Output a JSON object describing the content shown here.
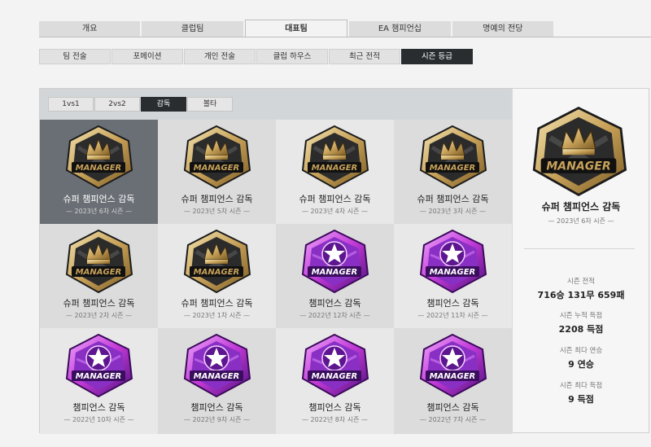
{
  "main_tabs": [
    {
      "label": "개요",
      "active": false
    },
    {
      "label": "클럽팀",
      "active": false
    },
    {
      "label": "대표팀",
      "active": true
    },
    {
      "label": "EA 챔피언십",
      "active": false
    },
    {
      "label": "명예의 전당",
      "active": false
    }
  ],
  "sub_tabs": [
    {
      "label": "팀 전술",
      "active": false
    },
    {
      "label": "포메이션",
      "active": false
    },
    {
      "label": "개인 전술",
      "active": false
    },
    {
      "label": "클럽 하우스",
      "active": false
    },
    {
      "label": "최근 전적",
      "active": false
    },
    {
      "label": "시즌 등급",
      "active": true
    }
  ],
  "mode_tabs": [
    {
      "label": "1vs1",
      "active": false
    },
    {
      "label": "2vs2",
      "active": false
    },
    {
      "label": "감독",
      "active": true
    },
    {
      "label": "볼타",
      "active": false
    }
  ],
  "badge_text": "MANAGER",
  "badges": [
    {
      "name": "슈퍼 챔피언스 감독",
      "season": "— 2023년 6차 시즌 —",
      "tier": "super",
      "selected": true
    },
    {
      "name": "슈퍼 챔피언스 감독",
      "season": "— 2023년 5차 시즌 —",
      "tier": "super",
      "selected": false
    },
    {
      "name": "슈퍼 챔피언스 감독",
      "season": "— 2023년 4차 시즌 —",
      "tier": "super",
      "selected": false
    },
    {
      "name": "슈퍼 챔피언스 감독",
      "season": "— 2023년 3차 시즌 —",
      "tier": "super",
      "selected": false
    },
    {
      "name": "슈퍼 챔피언스 감독",
      "season": "— 2023년 2차 시즌 —",
      "tier": "super",
      "selected": false
    },
    {
      "name": "슈퍼 챔피언스 감독",
      "season": "— 2023년 1차 시즌 —",
      "tier": "super",
      "selected": false
    },
    {
      "name": "챔피언스 감독",
      "season": "— 2022년 12차 시즌 —",
      "tier": "champions",
      "selected": false
    },
    {
      "name": "챔피언스 감독",
      "season": "— 2022년 11차 시즌 —",
      "tier": "champions",
      "selected": false
    },
    {
      "name": "챔피언스 감독",
      "season": "— 2022년 10차 시즌 —",
      "tier": "champions",
      "selected": false
    },
    {
      "name": "챔피언스 감독",
      "season": "— 2022년 9차 시즌 —",
      "tier": "champions",
      "selected": false
    },
    {
      "name": "챔피언스 감독",
      "season": "— 2022년 8차 시즌 —",
      "tier": "champions",
      "selected": false
    },
    {
      "name": "챔피언스 감독",
      "season": "— 2022년 7차 시즌 —",
      "tier": "champions",
      "selected": false
    }
  ],
  "detail": {
    "name": "슈퍼 챔피언스 감독",
    "season": "— 2023년 6차 시즌 —",
    "tier": "super",
    "stats": [
      {
        "label": "시즌 전적",
        "value": "716승 131무 659패"
      },
      {
        "label": "시즌 누적 득점",
        "value": "2208 득점"
      },
      {
        "label": "시즌 최다 연승",
        "value": "9 연승"
      },
      {
        "label": "시즌 최다 득점",
        "value": "9 득점"
      }
    ]
  },
  "colors": {
    "active_tab_dark": "#2a2d30",
    "super_gold": "#c8a25a",
    "super_dark": "#2b2b2b",
    "champions_purple": "#8a2fc4",
    "champions_magenta": "#c13ad6",
    "selected_cell": "#6a6f75"
  }
}
